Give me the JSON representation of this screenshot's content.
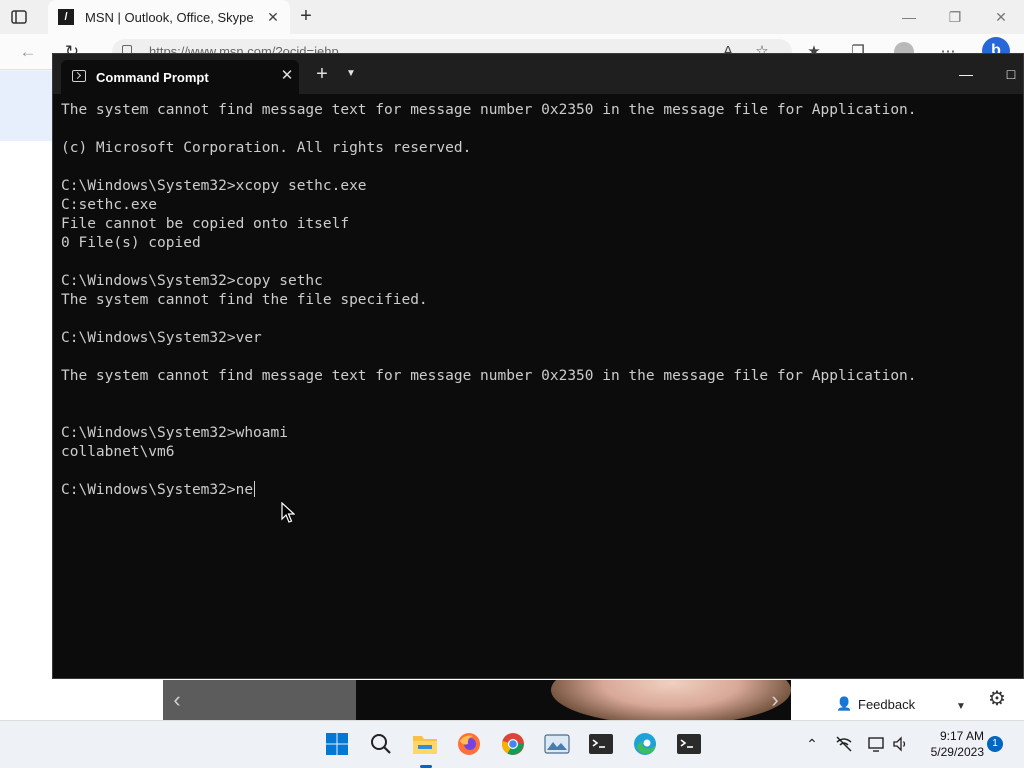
{
  "browser": {
    "tab_title": "MSN | Outlook, Office, Skype, Bi",
    "url": "https://www.msn.com/?ocid=iehp",
    "new_tab": "+",
    "tab_close": "✕",
    "minimize": "—",
    "restore": "❐",
    "close": "✕",
    "back": "←",
    "refresh": "↻"
  },
  "page": {
    "feedback_label": "Feedback"
  },
  "terminal": {
    "tab_title": "Command Prompt",
    "tab_close": "✕",
    "new_tab": "+",
    "dropdown": "⌄",
    "minimize": "—",
    "maximize": "□",
    "lines": [
      "The system cannot find message text for message number 0x2350 in the message file for Application.",
      "",
      "(c) Microsoft Corporation. All rights reserved.",
      "",
      "C:\\Windows\\System32>xcopy sethc.exe",
      "C:sethc.exe",
      "File cannot be copied onto itself",
      "0 File(s) copied",
      "",
      "C:\\Windows\\System32>copy sethc",
      "The system cannot find the file specified.",
      "",
      "C:\\Windows\\System32>ver",
      "",
      "The system cannot find message text for message number 0x2350 in the message file for Application.",
      "",
      "",
      "C:\\Windows\\System32>whoami",
      "collabnet\\vm6",
      "",
      "C:\\Windows\\System32>ne"
    ]
  },
  "taskbar": {
    "time": "9:17 AM",
    "date": "5/29/2023",
    "notification_count": "1",
    "apps": [
      "start-icon",
      "search-icon",
      "file-explorer-icon",
      "firefox-icon",
      "chrome-icon",
      "photos-icon",
      "terminal-icon",
      "edge-icon",
      "terminal-icon"
    ],
    "accent_color": "#0067c0"
  }
}
